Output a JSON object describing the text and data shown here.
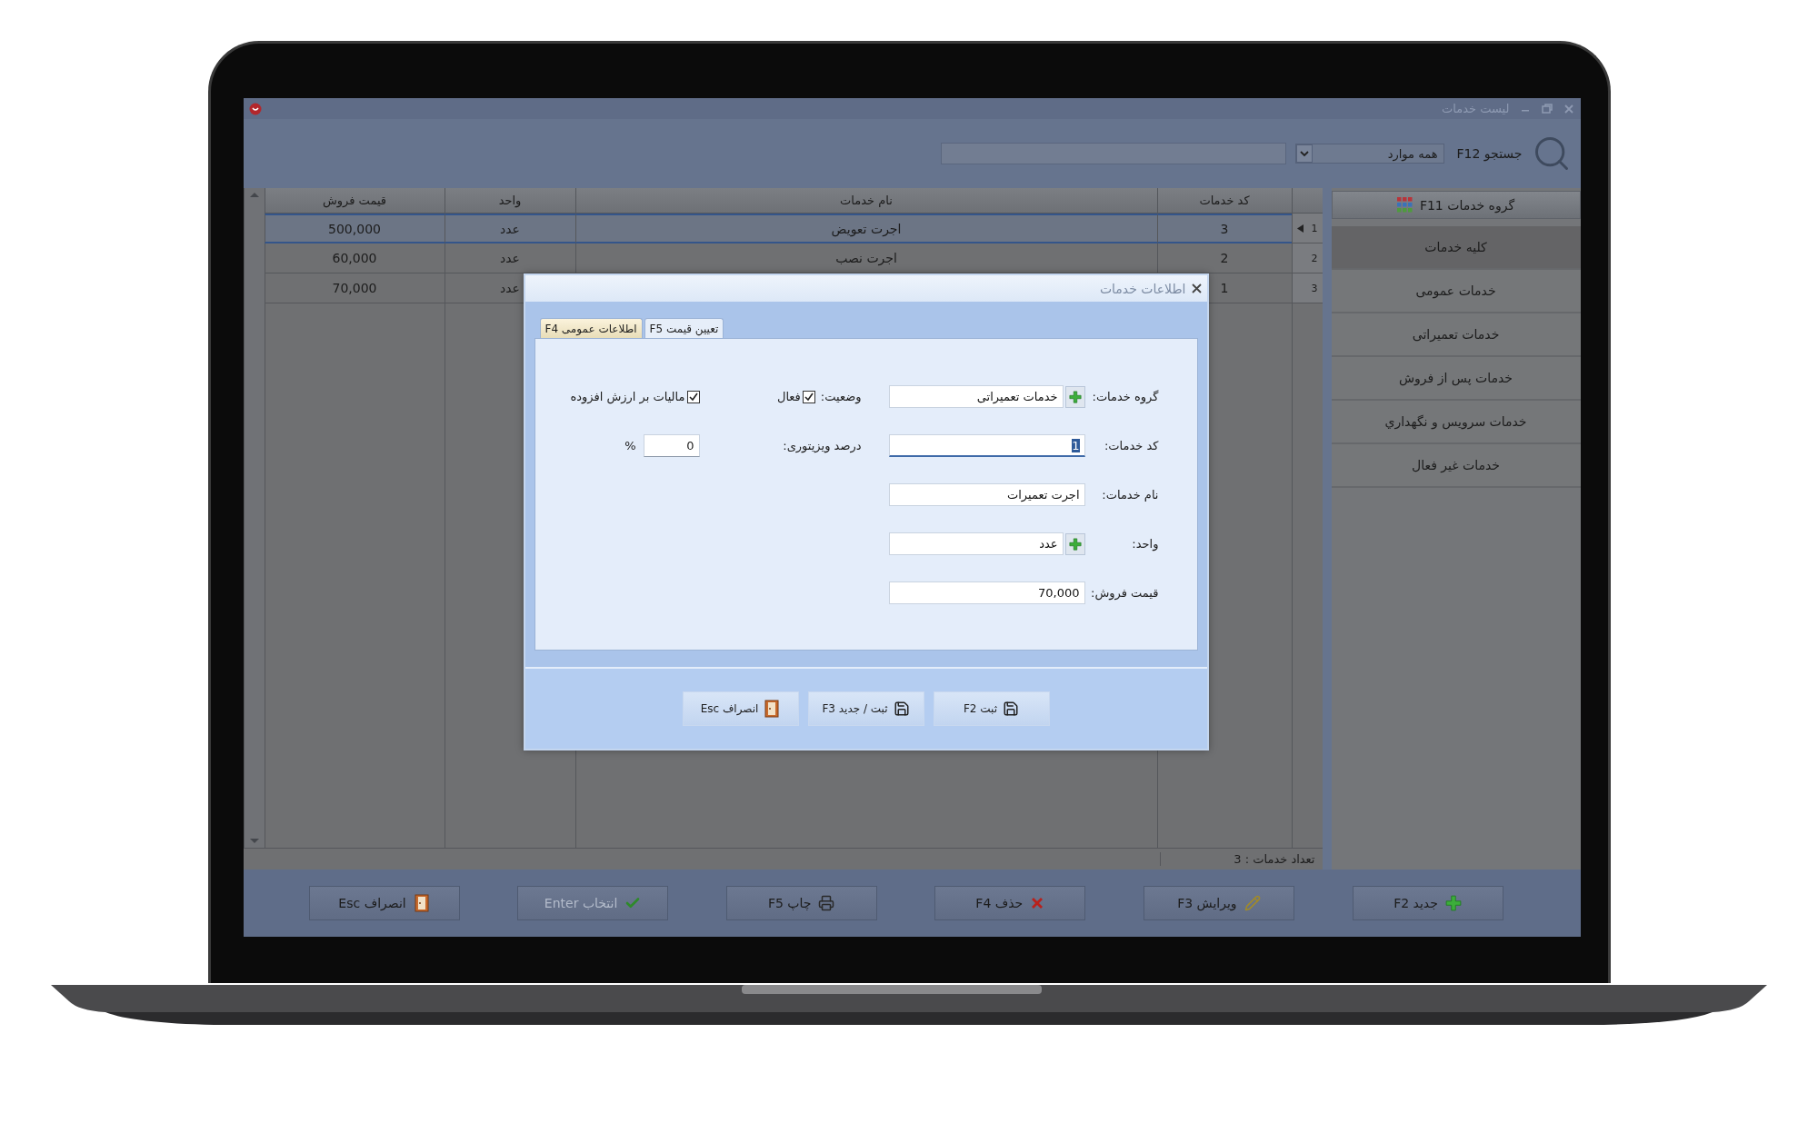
{
  "window": {
    "title": "لیست خدمات"
  },
  "search": {
    "label": "جستجو F12",
    "filter": "همه موارد"
  },
  "groups": {
    "button": "گروه خدمات F11",
    "items": [
      {
        "label": "کلیه خدمات",
        "selected": true
      },
      {
        "label": "خدمات عمومی",
        "selected": false
      },
      {
        "label": "خدمات تعمیراتی",
        "selected": false
      },
      {
        "label": "خدمات پس از فروش",
        "selected": false
      },
      {
        "label": "خدمات سرویس و نگهداري",
        "selected": false
      },
      {
        "label": "خدمات غیر فعال",
        "selected": false
      }
    ]
  },
  "table": {
    "columns": [
      "کد خدمات",
      "نام خدمات",
      "واحد",
      "قیمت فروش"
    ],
    "rows": [
      {
        "number": "1",
        "selected": true,
        "code": "3",
        "name": "اجرت تعویض",
        "unit": "عدد",
        "price": "500,000"
      },
      {
        "number": "2",
        "selected": false,
        "code": "2",
        "name": "اجرت نصب",
        "unit": "عدد",
        "price": "60,000"
      },
      {
        "number": "3",
        "selected": false,
        "code": "1",
        "unit": "عدد",
        "price": "70,000"
      }
    ]
  },
  "status_bar": {
    "count": "تعداد خدمات : 3"
  },
  "toolbar": [
    {
      "kind": "new",
      "label": "جدید F2",
      "disabled": false
    },
    {
      "kind": "edit",
      "label": "ویرایش F3",
      "disabled": false
    },
    {
      "kind": "delete",
      "label": "حذف F4",
      "disabled": false
    },
    {
      "kind": "print",
      "label": "چاپ F5",
      "disabled": false
    },
    {
      "kind": "select",
      "label": "انتخاب Enter",
      "disabled": true
    },
    {
      "kind": "cancel",
      "label": "انصراف Esc",
      "disabled": false
    }
  ],
  "dialog": {
    "title": "اطلاعات خدمات",
    "tabs": [
      {
        "label": "تعیین قیمت F5",
        "selected": false
      },
      {
        "label": "اطلاعات عمومی F4",
        "selected": true
      }
    ],
    "fields": [
      {
        "label": "گروه خدمات:",
        "value": "خدمات تعمیراتی",
        "add_button": true,
        "focused": false
      },
      {
        "label": "کد خدمات:",
        "value": "1",
        "add_button": false,
        "focused": true
      },
      {
        "label": "نام خدمات:",
        "value": "اجرت تعمیرات",
        "add_button": false,
        "focused": false
      },
      {
        "label": "واحد:",
        "value": "عدد",
        "add_button": true,
        "focused": false
      },
      {
        "label": "قیمت فروش:",
        "value": "70,000",
        "add_button": false,
        "focused": false
      }
    ],
    "status": {
      "label": "وضعیت:",
      "option": "فعال",
      "checked": true
    },
    "visitor": {
      "label": "درصد ویزیتوری:",
      "value": "0",
      "unit": "%"
    },
    "vat": {
      "label": "مالیات بر ارزش افزوده",
      "checked": true
    },
    "buttons": [
      {
        "kind": "save",
        "label": "ثبت F2"
      },
      {
        "kind": "save-new",
        "label": "ثبت / جدید F3"
      },
      {
        "kind": "cancel",
        "label": "انصراف Esc"
      }
    ]
  }
}
